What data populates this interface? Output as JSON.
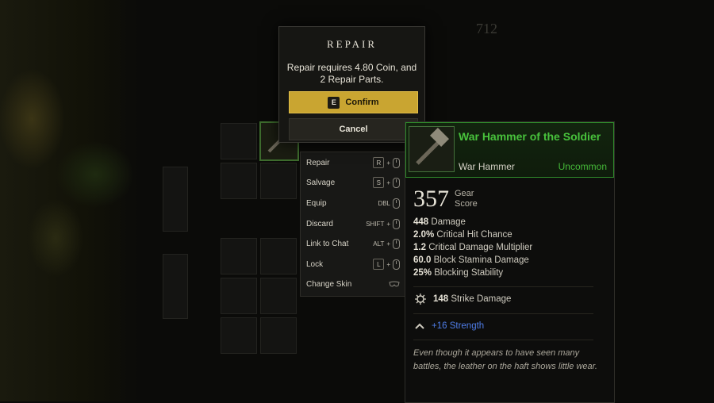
{
  "modal": {
    "title": "REPAIR",
    "message": "Repair requires 4.80 Coin, and 2 Repair Parts.",
    "confirm_key": "E",
    "confirm_label": "Confirm",
    "cancel_label": "Cancel"
  },
  "context_menu": [
    {
      "label": "Repair",
      "key": "R"
    },
    {
      "label": "Salvage",
      "key": "S"
    },
    {
      "label": "Equip",
      "key": "DBL"
    },
    {
      "label": "Discard",
      "key": "SHIFT"
    },
    {
      "label": "Link to Chat",
      "key": "ALT"
    },
    {
      "label": "Lock",
      "key": "L"
    },
    {
      "label": "Change Skin",
      "key": ""
    }
  ],
  "tooltip": {
    "name": "War Hammer of the Soldier",
    "type": "War Hammer",
    "rarity": "Uncommon",
    "gear_score": "357",
    "gear_score_label": "Gear Score",
    "stats": [
      {
        "value": "448",
        "label": "Damage"
      },
      {
        "value": "2.0%",
        "label": "Critical Hit Chance"
      },
      {
        "value": "1.2",
        "label": "Critical Damage Multiplier"
      },
      {
        "value": "60.0",
        "label": "Block Stamina Damage"
      },
      {
        "value": "25%",
        "label": "Blocking Stability"
      }
    ],
    "perk": {
      "value": "148",
      "label": "Strike Damage",
      "icon": "gear-icon"
    },
    "attribute": {
      "value": "+16",
      "label": "Strength",
      "icon": "chevron-up-icon"
    },
    "flavor": "Even though it appears to have seen many battles, the leather on the haft shows little wear."
  },
  "background": {
    "top_score": "712"
  },
  "colors": {
    "accent_gold": "#c9a531",
    "uncommon_green": "#48c23c",
    "attribute_blue": "#4f7de8"
  }
}
